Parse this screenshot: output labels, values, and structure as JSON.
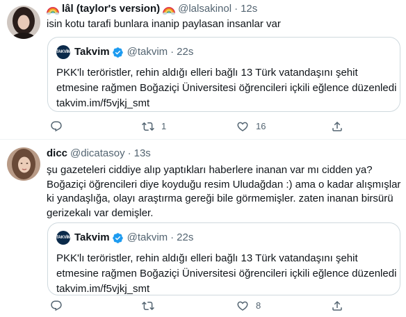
{
  "tweets": [
    {
      "author": {
        "display_name": "lâl (taylor's version)",
        "handle": "@lalsakinol",
        "emoji": "rainbow"
      },
      "time": "12s",
      "text_lines": [
        "isin kotu tarafi bunlara inanip paylasan insanlar var"
      ],
      "quote": {
        "display_name": "Takvim",
        "logo_text": "TAKVİM",
        "verified": true,
        "handle": "@takvim",
        "time": "22s",
        "text_lines": [
          "PKK'lı teröristler, rehin aldığı elleri bağlı 13 Türk vatandaşını şehit",
          "etmesine rağmen Boğaziçi Üniversitesi öğrencileri içkili eğlence düzenledi",
          "takvim.im/f5vjkj_smt"
        ]
      },
      "actions": {
        "reply": "",
        "retweet": "1",
        "like": "16",
        "share": ""
      }
    },
    {
      "author": {
        "display_name": "dicc",
        "handle": "@dicatasoy"
      },
      "time": "13s",
      "text_lines": [
        "şu gazeteleri ciddiye alıp yaptıkları haberlere inanan var mı cidden ya?",
        "Boğaziçi öğrencileri diye koyduğu resim Uludağdan :) ama o kadar alışmışlar",
        "ki yandaşlığa, olayı araştırma gereği bile görmemişler. zaten inanan birsürü",
        "gerizekalı var demişler."
      ],
      "quote": {
        "display_name": "Takvim",
        "logo_text": "TAKVİM",
        "verified": true,
        "handle": "@takvim",
        "time": "22s",
        "text_lines": [
          "PKK'lı teröristler, rehin aldığı elleri bağlı 13 Türk vatandaşını şehit",
          "etmesine rağmen Boğaziçi Üniversitesi öğrencileri içkili eğlence düzenledi",
          "takvim.im/f5vjkj_smt"
        ]
      },
      "actions": {
        "reply": "",
        "retweet": "",
        "like": "8",
        "share": ""
      }
    }
  ],
  "colors": {
    "text": "#0f1419",
    "secondary": "#536471",
    "verified": "#1d9bf0",
    "border": "#cfd9de",
    "divider": "#eff3f4"
  }
}
